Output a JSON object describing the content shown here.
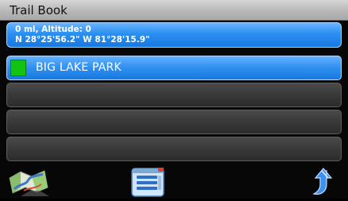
{
  "title_bar": {
    "title": "Trail Book"
  },
  "location": {
    "line1": "0 mi, Altitude: 0",
    "line2": "N 28°25'56.2\"  W 81°28'15.9\""
  },
  "trail_list": {
    "items": [
      {
        "name": "BIG LAKE PARK",
        "color": "#13c313",
        "selected": true
      },
      {
        "name": "",
        "selected": false
      },
      {
        "name": "",
        "selected": false
      },
      {
        "name": "",
        "selected": false
      },
      {
        "name": "",
        "selected": false
      }
    ]
  },
  "toolbar": {
    "icons": [
      "map-icon",
      "list-menu-icon",
      "back-arrow-icon"
    ]
  },
  "colors": {
    "selected_blue": "#2e8ff0",
    "title_gray": "#c2c2c2",
    "swatch_green": "#13c313"
  }
}
